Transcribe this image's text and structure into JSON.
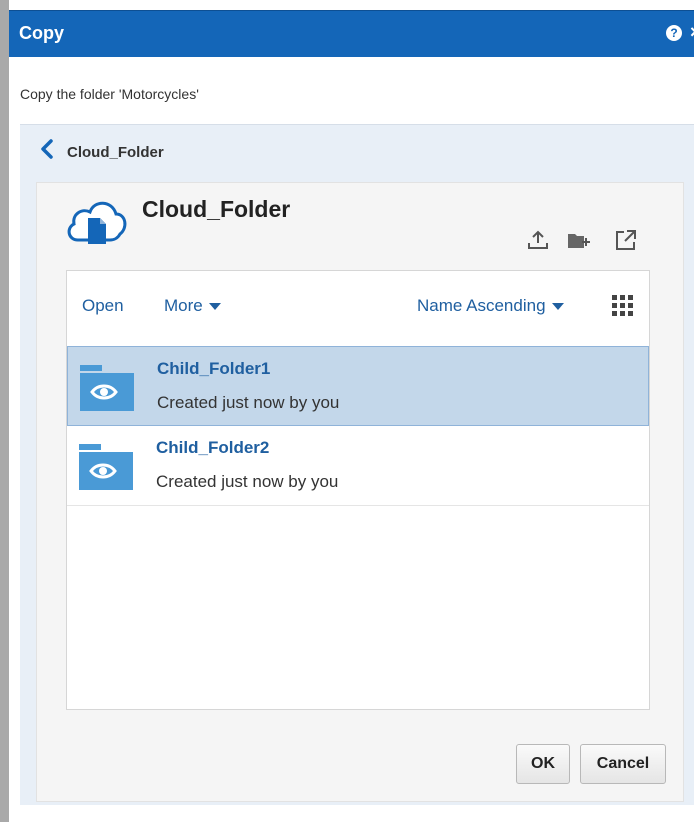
{
  "dialog": {
    "title": "Copy",
    "description": "Copy the folder 'Motorcycles'",
    "help_icon": "help-icon",
    "close_icon": "close-icon",
    "accent_color": "#1466b8"
  },
  "breadcrumb": {
    "label": "Cloud_Folder",
    "icon": "chevron-left-icon"
  },
  "folder": {
    "heading": "Cloud_Folder",
    "icon": "cloud-document-icon",
    "toolbar": [
      "upload-icon",
      "new-folder-icon",
      "open-external-icon"
    ]
  },
  "list": {
    "open_label": "Open",
    "more_label": "More",
    "sort_label": "Name Ascending",
    "view_icon": "grid-view-icon",
    "items": [
      {
        "name": "Child_Folder1",
        "meta": "Created just now by you",
        "selected": true,
        "icon": "shared-folder-icon"
      },
      {
        "name": "Child_Folder2",
        "meta": "Created just now by you",
        "selected": false,
        "icon": "shared-folder-icon"
      }
    ]
  },
  "buttons": {
    "ok": "OK",
    "cancel": "Cancel"
  }
}
